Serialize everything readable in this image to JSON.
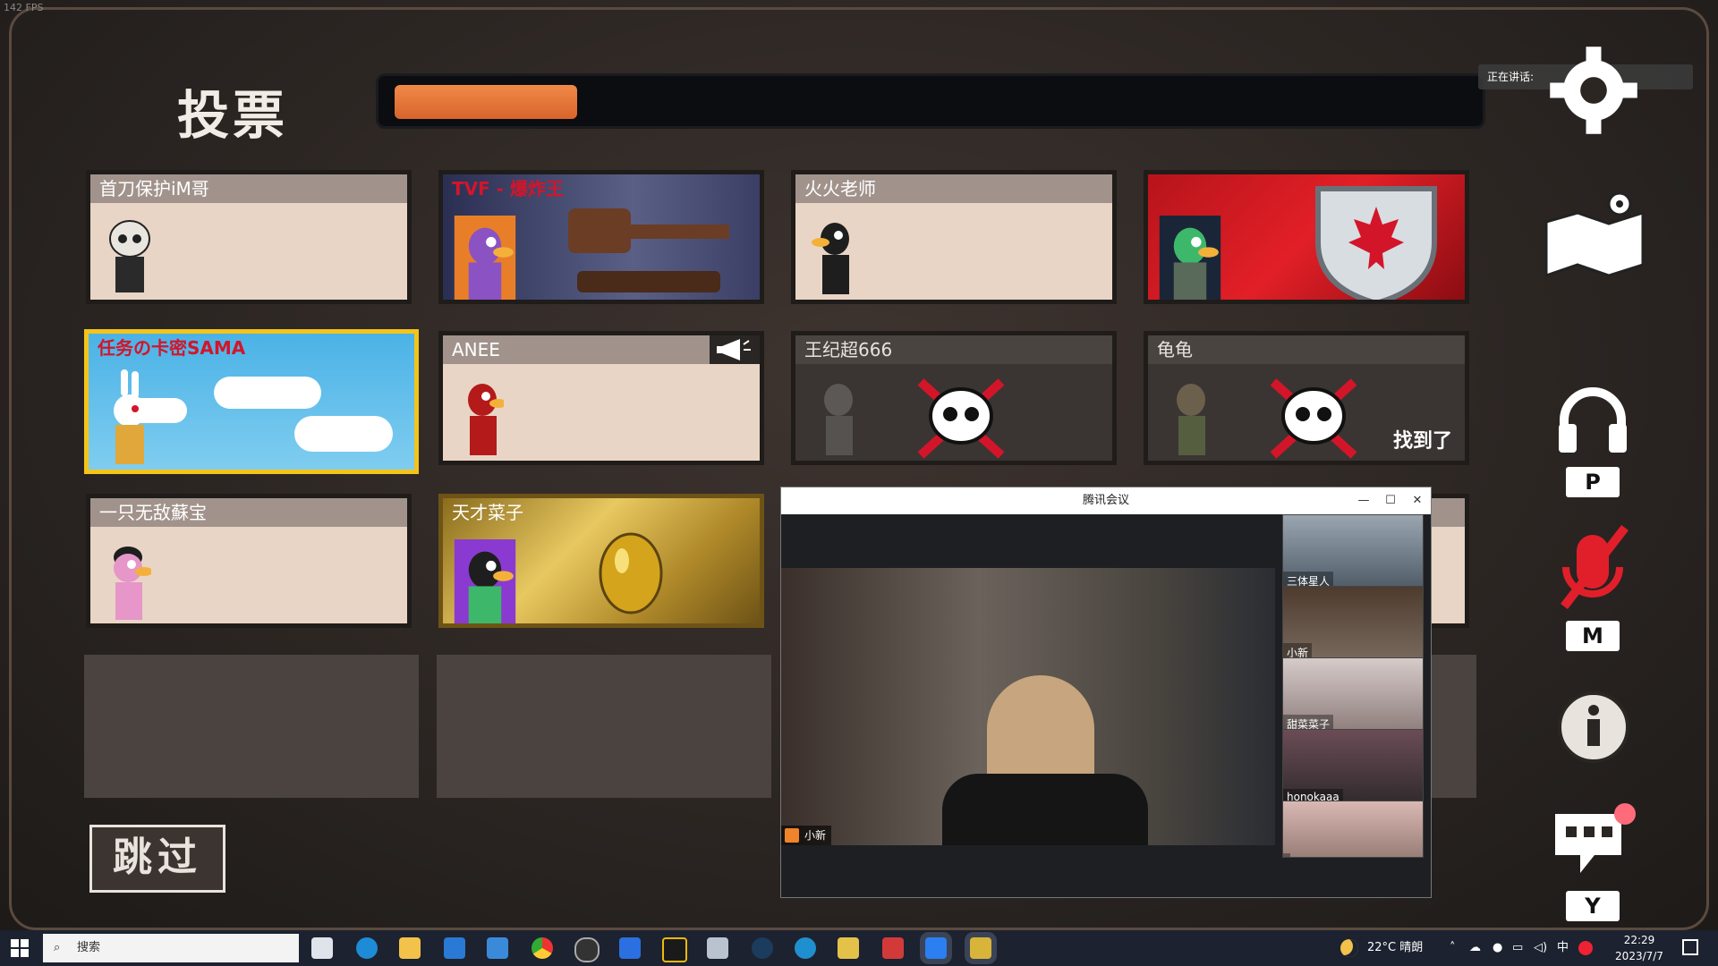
{
  "game": {
    "fps_text": "142 FPS",
    "title": "投票",
    "timer_progress": 0.17,
    "speaking_label": "正在讲话:",
    "skip_label": "跳过",
    "hotkeys": {
      "voice": "P",
      "mute": "M",
      "chat": "Y"
    },
    "players": [
      {
        "name": "首刀保护iM哥",
        "state": "alive"
      },
      {
        "name": "TVF - 爆炸王",
        "state": "alive-skin"
      },
      {
        "name": "火火老师",
        "state": "alive"
      },
      {
        "name": "",
        "state": "alive-skin"
      },
      {
        "name": "任务の卡密SAMA",
        "state": "selected"
      },
      {
        "name": "ANEE",
        "state": "alive-speaking"
      },
      {
        "name": "王纪超666",
        "state": "dead"
      },
      {
        "name": "龟龟",
        "state": "dead"
      },
      {
        "name": "一只无敌蘇宝",
        "state": "alive"
      },
      {
        "name": "天才菜子",
        "state": "alive-skin"
      }
    ],
    "found_label": "找到了"
  },
  "meeting": {
    "title": "腾讯会议",
    "speaker": "小新",
    "participants": [
      {
        "name": "三体星人"
      },
      {
        "name": "小新"
      },
      {
        "name": "甜菜菜子"
      },
      {
        "name": "honokaaa"
      },
      {
        "name": ""
      }
    ]
  },
  "taskbar": {
    "search_placeholder": "搜索",
    "weather": "22°C 晴朗",
    "ime": "中",
    "time": "22:29",
    "date": "2023/7/7"
  }
}
